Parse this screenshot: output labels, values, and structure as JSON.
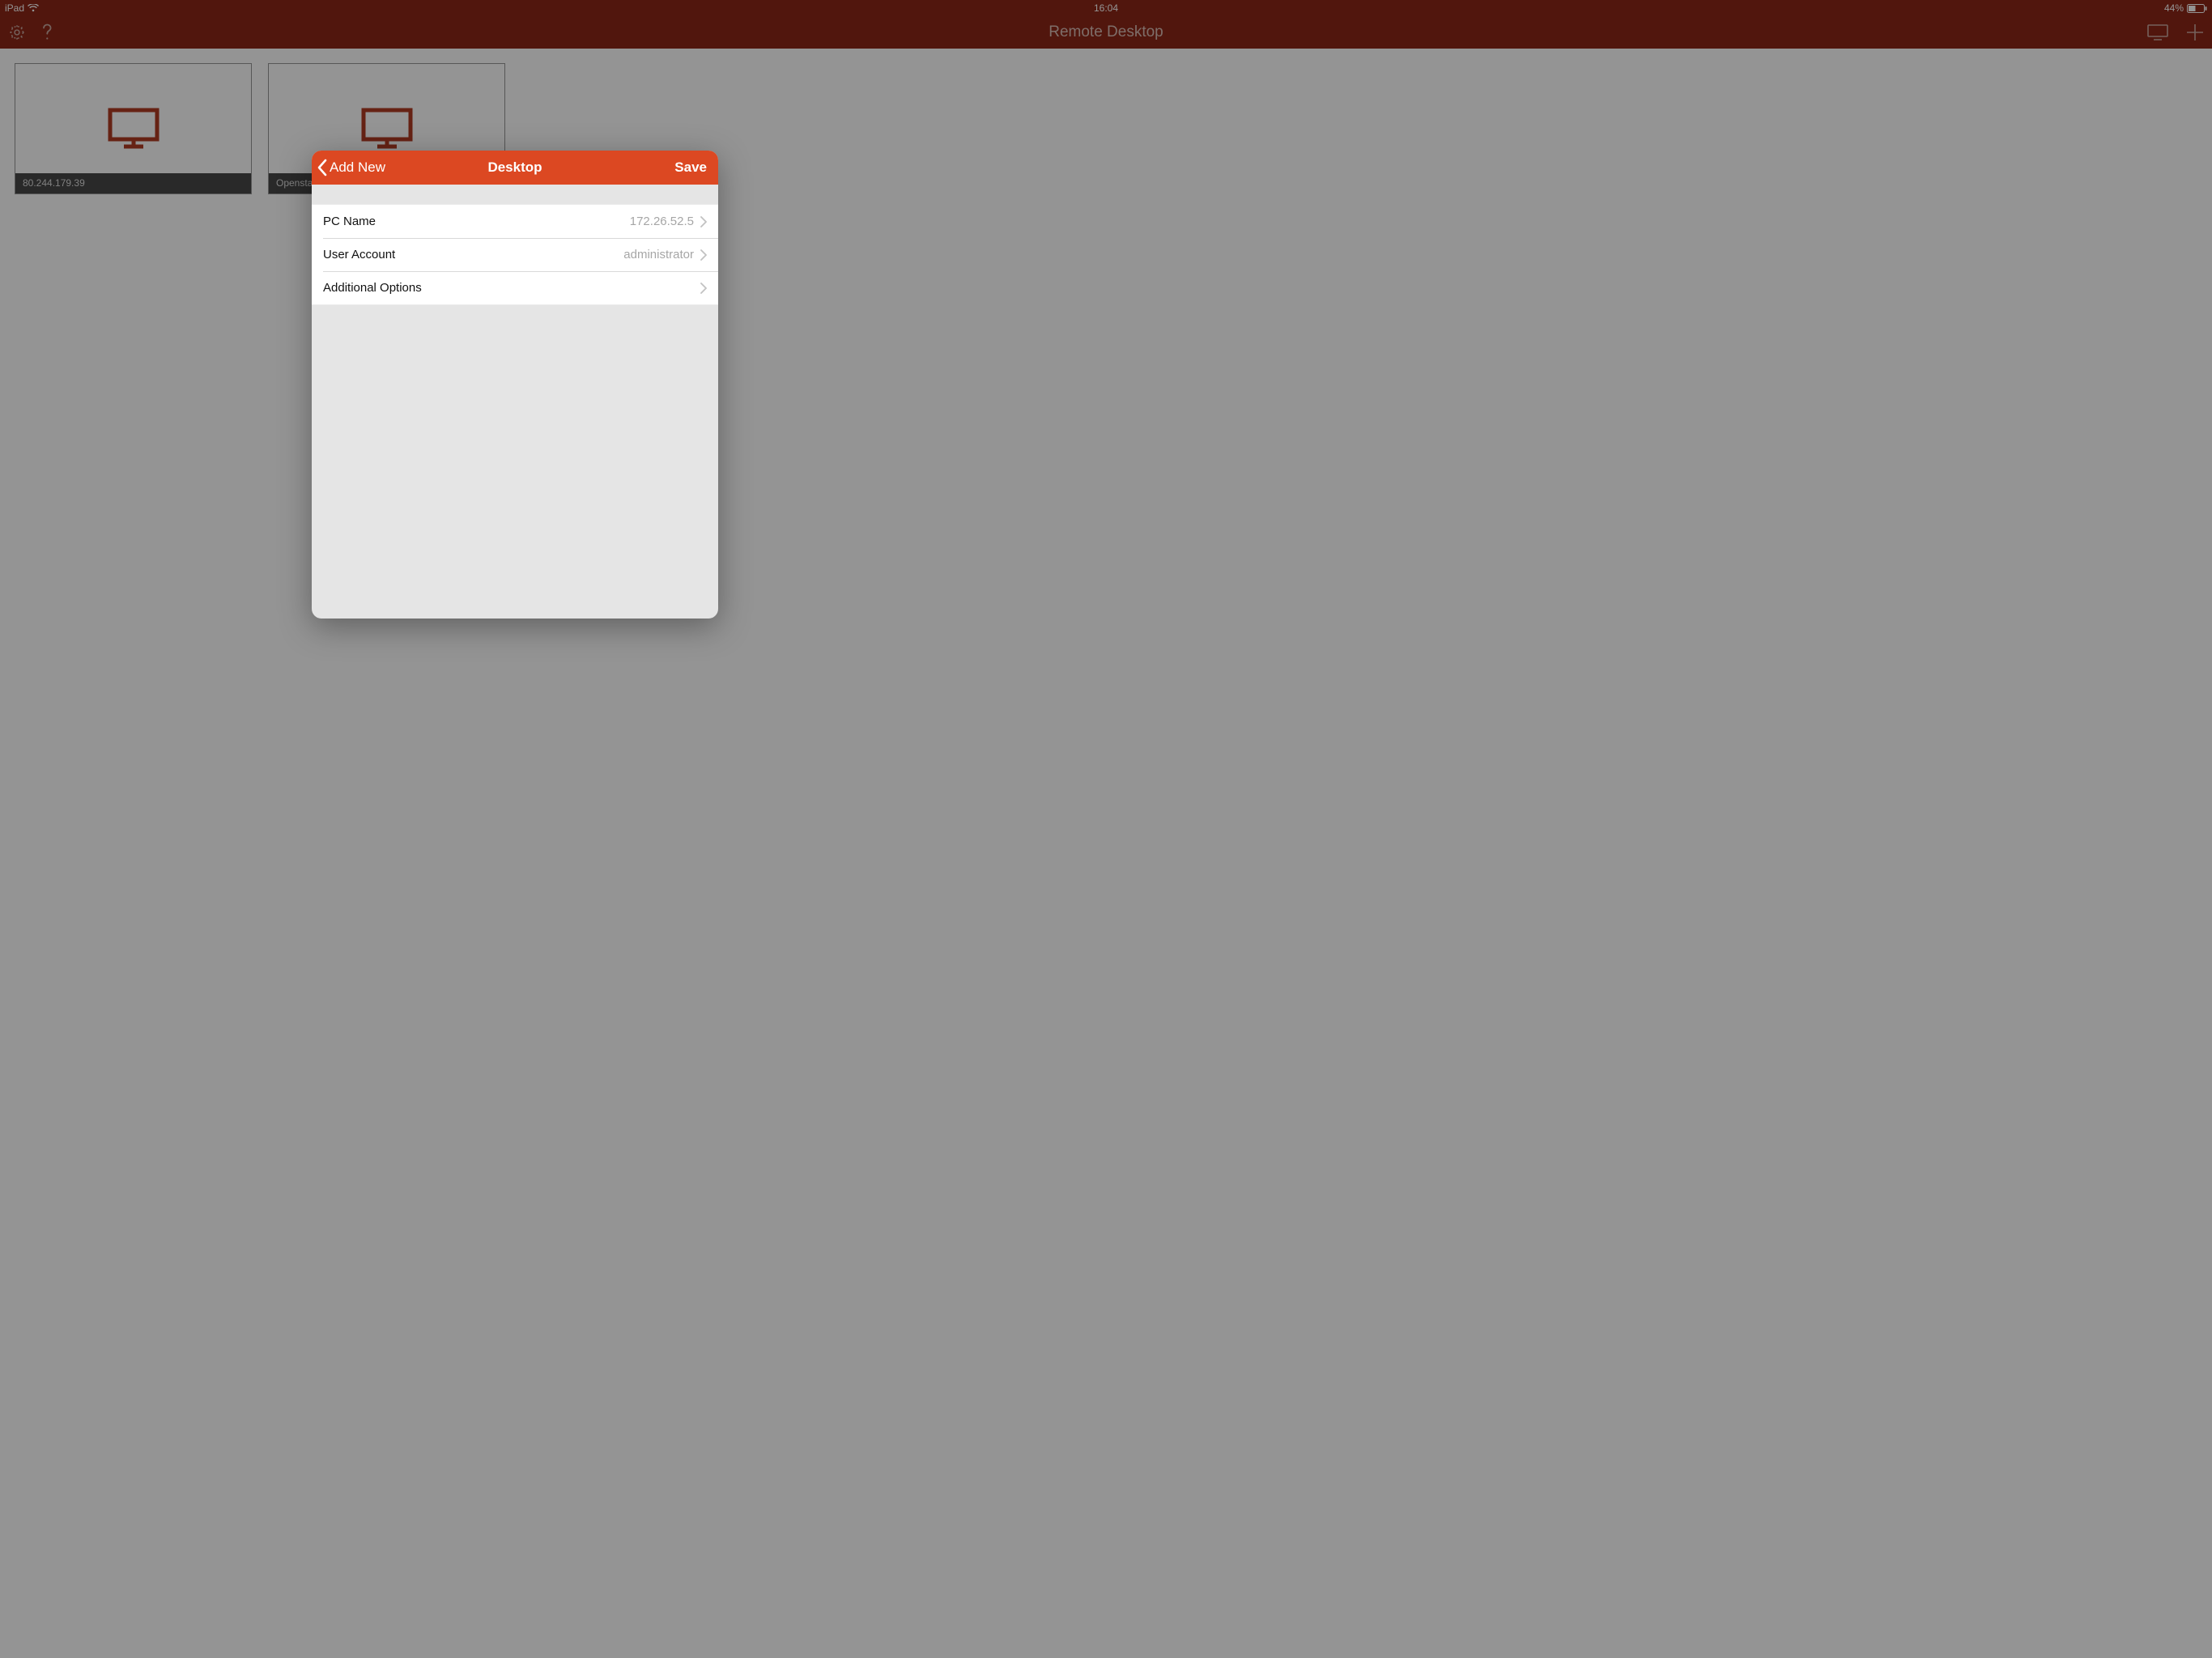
{
  "status_bar": {
    "device_label": "iPad",
    "time": "16:04",
    "battery_percent": "44%"
  },
  "nav": {
    "title": "Remote Desktop"
  },
  "tiles": [
    {
      "caption": "80.244.179.39"
    },
    {
      "caption": "Openstack"
    }
  ],
  "modal": {
    "back_label": "Add New",
    "title": "Desktop",
    "save_label": "Save",
    "rows": {
      "pc_name": {
        "label": "PC Name",
        "value": "172.26.52.5"
      },
      "user_account": {
        "label": "User Account",
        "value": "administrator"
      },
      "additional": {
        "label": "Additional Options"
      }
    }
  }
}
